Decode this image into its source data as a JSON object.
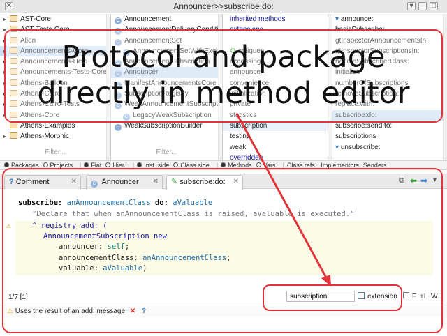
{
  "window": {
    "title": "Announcer>>subscribe:do:"
  },
  "packages": {
    "items": [
      {
        "label": "AST-Core",
        "tri": "▸"
      },
      {
        "label": "AST-Tests-Core",
        "tri": "▸"
      },
      {
        "label": "Alien",
        "tri": "▸"
      },
      {
        "label": "Announcements-Core",
        "tri": "▸"
      },
      {
        "label": "Announcements-Help",
        "tri": "▸"
      },
      {
        "label": "Announcements-Tests-Core",
        "tri": "▸"
      },
      {
        "label": "Athens-Balloon",
        "tri": "▸"
      },
      {
        "label": "Athens-Cairo",
        "tri": "▸"
      },
      {
        "label": "Athens-Cairo-Tests",
        "tri": "▸"
      },
      {
        "label": "Athens-Core",
        "tri": "▸"
      },
      {
        "label": "Athens-Examples",
        "tri": ""
      },
      {
        "label": "Athens-Morphic",
        "tri": "▸"
      }
    ],
    "filter": "Filter..."
  },
  "classes": {
    "items": [
      {
        "label": "Announcement",
        "indent": 0
      },
      {
        "label": "AnnouncementDeliveryCondition",
        "indent": 0
      },
      {
        "label": "AnnouncementSet",
        "indent": 0
      },
      {
        "label": "AnnouncementSetWithExclusions",
        "indent": 1
      },
      {
        "label": "AnnouncementSubscription",
        "indent": 0
      },
      {
        "label": "Announcer",
        "indent": 0
      },
      {
        "label": "ManifestAnnouncementsCore",
        "indent": 0
      },
      {
        "label": "SubscriptionRegistry",
        "indent": 0
      },
      {
        "label": "WeakAnnouncementSubscription",
        "indent": 0
      },
      {
        "label": "LegacyWeakSubscription",
        "indent": 1
      },
      {
        "label": "WeakSubscriptionBuilder",
        "indent": 0
      }
    ],
    "filter": "Filter..."
  },
  "protocols": {
    "items": [
      "inherited methods",
      "extensions",
      "",
      "critiques",
      "accessing",
      "announce",
      "convenience",
      "initialization",
      "private",
      "statistics",
      "subscription",
      "testing",
      "weak",
      "overridden"
    ]
  },
  "methods": {
    "items": [
      "announce:",
      "basicSubscribe:",
      "gtInspectorAnnouncementsIn:",
      "gtInspectorSubscriptionsIn:",
      "handleSubscriberClass:",
      "initialize",
      "numberOfSubscriptions",
      "removeSubscription:",
      "replace:with:",
      "subscribe:do:",
      "subscribe:send:to:",
      "subscriptions",
      "unsubscribe:"
    ]
  },
  "radiobar": {
    "items": [
      {
        "label": "Packages",
        "on": true
      },
      {
        "label": "Projects",
        "on": false
      },
      {
        "sep": "|"
      },
      {
        "label": "Flat",
        "on": true
      },
      {
        "label": "Hier.",
        "on": false
      },
      {
        "sep": "|"
      },
      {
        "label": "Inst. side",
        "on": true
      },
      {
        "label": "Class side",
        "on": false
      },
      {
        "sep": "|"
      },
      {
        "label": "Methods",
        "on": true
      },
      {
        "label": "Vars",
        "on": false
      },
      {
        "sep": "|"
      },
      {
        "text": "Class refs."
      },
      {
        "text": "Implementors"
      },
      {
        "text": "Senders"
      }
    ]
  },
  "tabs": [
    {
      "label": "Comment",
      "icon": "?"
    },
    {
      "label": "Announcer",
      "icon": "C"
    },
    {
      "label": "subscribe:do:",
      "icon": "✎"
    }
  ],
  "code": {
    "l1_a": "subscribe:",
    "l1_b": " anAnnouncementClass ",
    "l1_c": "do:",
    "l1_d": " aValuable",
    "l2": "\"Declare that when anAnnouncementClass is raised, aValuable is executed.\"",
    "l3_a": "^ ",
    "l3_b": "registry",
    "l3_c": " add: (",
    "l4_a": "AnnouncementSubscription",
    "l4_b": " new",
    "l5_a": "announcer: ",
    "l5_b": "self",
    "l5_c": ";",
    "l6_a": "announcementClass: ",
    "l6_b": "anAnnouncementClass",
    "l6_c": ";",
    "l7_a": "valuable: ",
    "l7_b": "aValuable",
    "l7_c": ")"
  },
  "status": {
    "position": "1/7 [1]",
    "protocol_input": "subscription",
    "extension_label": "extension",
    "flags": [
      "F",
      "+L",
      "W"
    ]
  },
  "footer": {
    "critique": "Uses the result of an add: message",
    "close": "✕",
    "help": "?"
  },
  "annotation": {
    "line1": "Protocol and package",
    "line2": "directly in method editor",
    "color": "#e0333a"
  },
  "colors": {
    "selection": "#cfe0f5",
    "code_highlight": "#fbfbe6",
    "accent": "#1a1aa6"
  }
}
